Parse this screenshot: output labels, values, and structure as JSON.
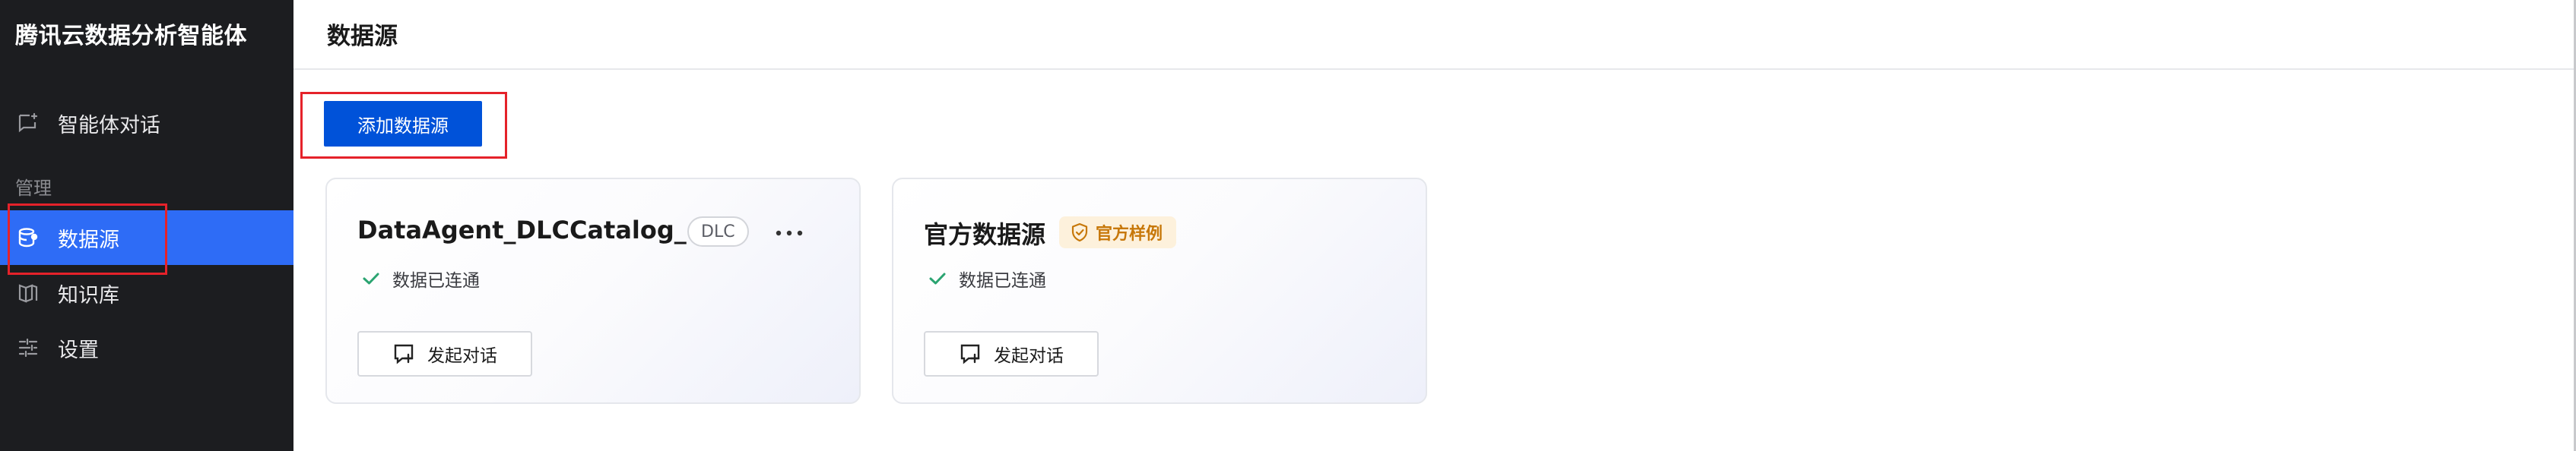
{
  "app": {
    "title": "腾讯云数据分析智能体"
  },
  "sidebar": {
    "items": [
      {
        "label": "智能体对话",
        "icon": "chat-bubble-icon",
        "active": false
      },
      {
        "label": "数据源",
        "icon": "database-icon",
        "active": true
      },
      {
        "label": "知识库",
        "icon": "book-icon",
        "active": false
      },
      {
        "label": "设置",
        "icon": "sliders-icon",
        "active": false
      }
    ],
    "section_label": "管理"
  },
  "page": {
    "title": "数据源",
    "add_button_label": "添加数据源"
  },
  "cards": [
    {
      "title": "DataAgent_DLCCatalog_...",
      "tag": "DLC",
      "status": "数据已连通",
      "action_label": "发起对话",
      "has_more_menu": true
    },
    {
      "title": "官方数据源",
      "badge": "官方样例",
      "status": "数据已连通",
      "action_label": "发起对话",
      "has_more_menu": false
    }
  ],
  "colors": {
    "sidebar_bg": "#1c1d20",
    "active_item": "#2e6cf6",
    "primary_button": "#0052d9",
    "success_check": "#2ba471",
    "official_badge_bg": "#fdf1dc",
    "official_badge_text": "#c7780a",
    "highlight_box": "#e5222a"
  }
}
